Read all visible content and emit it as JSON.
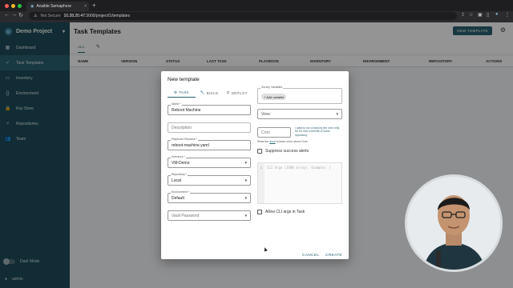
{
  "browser": {
    "tab_title": "Ansible Semaphore",
    "tab_close": "×",
    "new_tab": "+",
    "security_label": "Not Secure",
    "url_host": "10.28.20.47",
    "url_path": ":3000/project/1/templates"
  },
  "sidebar": {
    "project_name": "Demo Project",
    "project_initial": "D",
    "items": [
      {
        "label": "Dashboard",
        "icon": "dashboard-icon",
        "glyph": "▦"
      },
      {
        "label": "Task Templates",
        "icon": "templates-icon",
        "glyph": "✓"
      },
      {
        "label": "Inventory",
        "icon": "inventory-icon",
        "glyph": "▭"
      },
      {
        "label": "Environment",
        "icon": "environment-icon",
        "glyph": "{}"
      },
      {
        "label": "Key Store",
        "icon": "key-icon",
        "glyph": "🔒"
      },
      {
        "label": "Repositories",
        "icon": "repository-icon",
        "glyph": "⑂"
      },
      {
        "label": "Team",
        "icon": "team-icon",
        "glyph": "👥"
      }
    ],
    "dark_mode_label": "Dark Mode",
    "user_name": "admin"
  },
  "header": {
    "title": "Task Templates",
    "new_button": "NEW TEMPLATE"
  },
  "tabs": {
    "all": "ALL"
  },
  "table": {
    "columns": [
      "NAME",
      "VERSION",
      "STATUS",
      "LAST TASK",
      "PLAYBOOK",
      "INVENTORY",
      "ENVIRONMENT",
      "REPOSITORY",
      "ACTIONS"
    ]
  },
  "dialog": {
    "title": "New template",
    "tabs": {
      "task": "TASK",
      "build": "BUILD",
      "deploy": "DEPLOY"
    },
    "name_label": "Name *",
    "name_value": "Reboot Machine",
    "description_placeholder": "Description",
    "playbook_label": "Playbook Filename *",
    "playbook_value": "reboot-machine.yaml",
    "inventory_label": "Inventory *",
    "inventory_value": "VM-Demo",
    "repository_label": "Repository *",
    "repository_value": "Local",
    "environment_label": "Environment *",
    "environment_value": "Default",
    "vault_placeholder": "Vault Password",
    "survey_label": "Survey Variables",
    "add_variable": "+ Add variable",
    "view_placeholder": "View",
    "cron_placeholder": "Cron",
    "cron_hint": "I want to run a task by the cron only for for new commits of some repository",
    "cron_read_prefix": "Read the",
    "cron_read_link": "docs",
    "cron_read_suffix": "to learn more about Cron.",
    "suppress_label": "Suppress success alerts",
    "code_line": "1",
    "code_placeholder": "CLI Args (JSON array). Example: [",
    "allow_cli_label": "Allow CLI args in Task",
    "cancel": "CANCEL",
    "create": "CREATE"
  }
}
